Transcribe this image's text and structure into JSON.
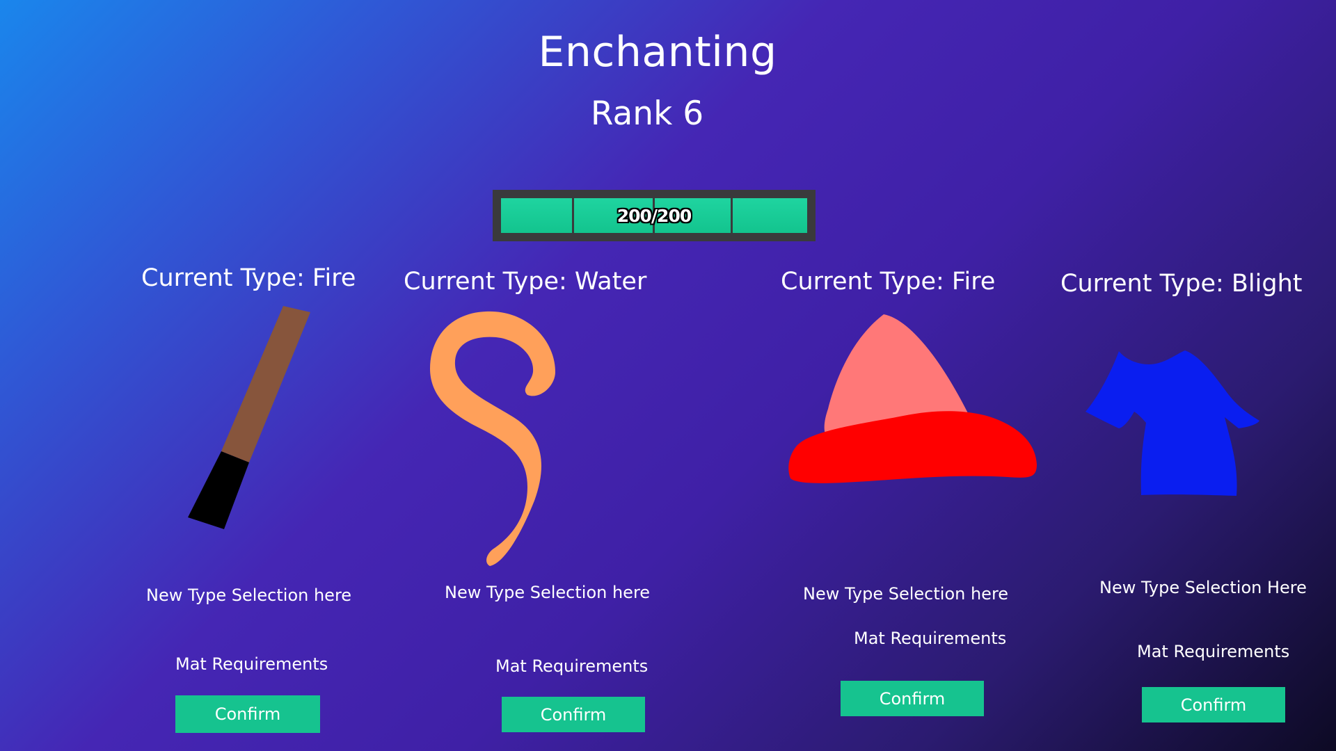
{
  "header": {
    "title": "Enchanting",
    "rank": "Rank 6"
  },
  "xp_bar": {
    "text": "200/200",
    "current": 200,
    "max": 200,
    "fill_color": "#16c38f"
  },
  "items": [
    {
      "icon": "wand-icon",
      "current_type": "Current Type: Fire",
      "selection": "New Type Selection here",
      "mat_requirements": "Mat Requirements",
      "confirm": "Confirm"
    },
    {
      "icon": "tail-icon",
      "current_type": "Current Type: Water",
      "selection": "New Type Selection here",
      "mat_requirements": "Mat Requirements",
      "confirm": "Confirm"
    },
    {
      "icon": "hat-icon",
      "current_type": "Current Type: Fire",
      "selection": "New Type Selection here",
      "mat_requirements": "Mat Requirements",
      "confirm": "Confirm"
    },
    {
      "icon": "robe-icon",
      "current_type": "Current Type: Blight",
      "selection": "New Type Selection Here",
      "mat_requirements": "Mat Requirements",
      "confirm": "Confirm"
    }
  ],
  "colors": {
    "confirm_button": "#16c38f",
    "xp_frame": "#3a3a3c"
  }
}
